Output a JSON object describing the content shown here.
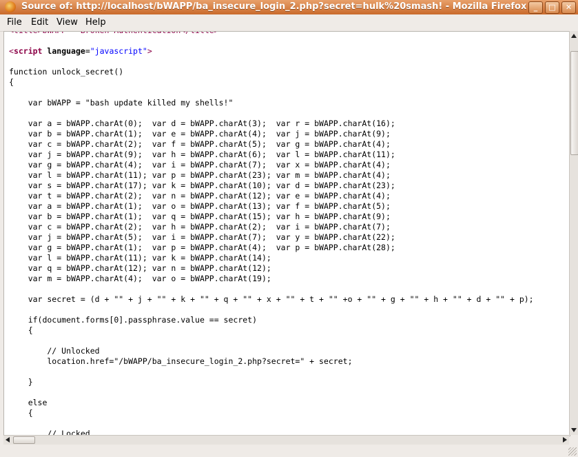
{
  "window": {
    "title": "Source of: http://localhost/bWAPP/ba_insecure_login_2.php?secret=hulk%20smash! - Mozilla Firefox",
    "buttons": {
      "minimize": "_",
      "maximize": "□",
      "close": "✕"
    },
    "icon": "firefox-icon"
  },
  "menu": {
    "file": "File",
    "edit": "Edit",
    "view": "View",
    "help": "Help"
  },
  "source": {
    "lines": [
      "<title>bWAPP - Broken Authentication</title>",
      "",
      "<script language=\"javascript\">",
      "",
      "function unlock_secret()",
      "{",
      "",
      "    var bWAPP = \"bash update killed my shells!\"",
      "",
      "    var a = bWAPP.charAt(0);  var d = bWAPP.charAt(3);  var r = bWAPP.charAt(16);",
      "    var b = bWAPP.charAt(1);  var e = bWAPP.charAt(4);  var j = bWAPP.charAt(9);",
      "    var c = bWAPP.charAt(2);  var f = bWAPP.charAt(5);  var g = bWAPP.charAt(4);",
      "    var j = bWAPP.charAt(9);  var h = bWAPP.charAt(6);  var l = bWAPP.charAt(11);",
      "    var g = bWAPP.charAt(4);  var i = bWAPP.charAt(7);  var x = bWAPP.charAt(4);",
      "    var l = bWAPP.charAt(11); var p = bWAPP.charAt(23); var m = bWAPP.charAt(4);",
      "    var s = bWAPP.charAt(17); var k = bWAPP.charAt(10); var d = bWAPP.charAt(23);",
      "    var t = bWAPP.charAt(2);  var n = bWAPP.charAt(12); var e = bWAPP.charAt(4);",
      "    var a = bWAPP.charAt(1);  var o = bWAPP.charAt(13); var f = bWAPP.charAt(5);",
      "    var b = bWAPP.charAt(1);  var q = bWAPP.charAt(15); var h = bWAPP.charAt(9);",
      "    var c = bWAPP.charAt(2);  var h = bWAPP.charAt(2);  var i = bWAPP.charAt(7);",
      "    var j = bWAPP.charAt(5);  var i = bWAPP.charAt(7);  var y = bWAPP.charAt(22);",
      "    var g = bWAPP.charAt(1);  var p = bWAPP.charAt(4);  var p = bWAPP.charAt(28);",
      "    var l = bWAPP.charAt(11); var k = bWAPP.charAt(14);",
      "    var q = bWAPP.charAt(12); var n = bWAPP.charAt(12);",
      "    var m = bWAPP.charAt(4);  var o = bWAPP.charAt(19);",
      "",
      "    var secret = (d + \"\" + j + \"\" + k + \"\" + q + \"\" + x + \"\" + t + \"\" +o + \"\" + g + \"\" + h + \"\" + d + \"\" + p);",
      "",
      "    if(document.forms[0].passphrase.value == secret)",
      "    {",
      "",
      "        // Unlocked",
      "        location.href=\"/bWAPP/ba_insecure_login_2.php?secret=\" + secret;",
      "",
      "    }",
      "",
      "    else",
      "    {",
      "",
      "        // Locked"
    ]
  }
}
